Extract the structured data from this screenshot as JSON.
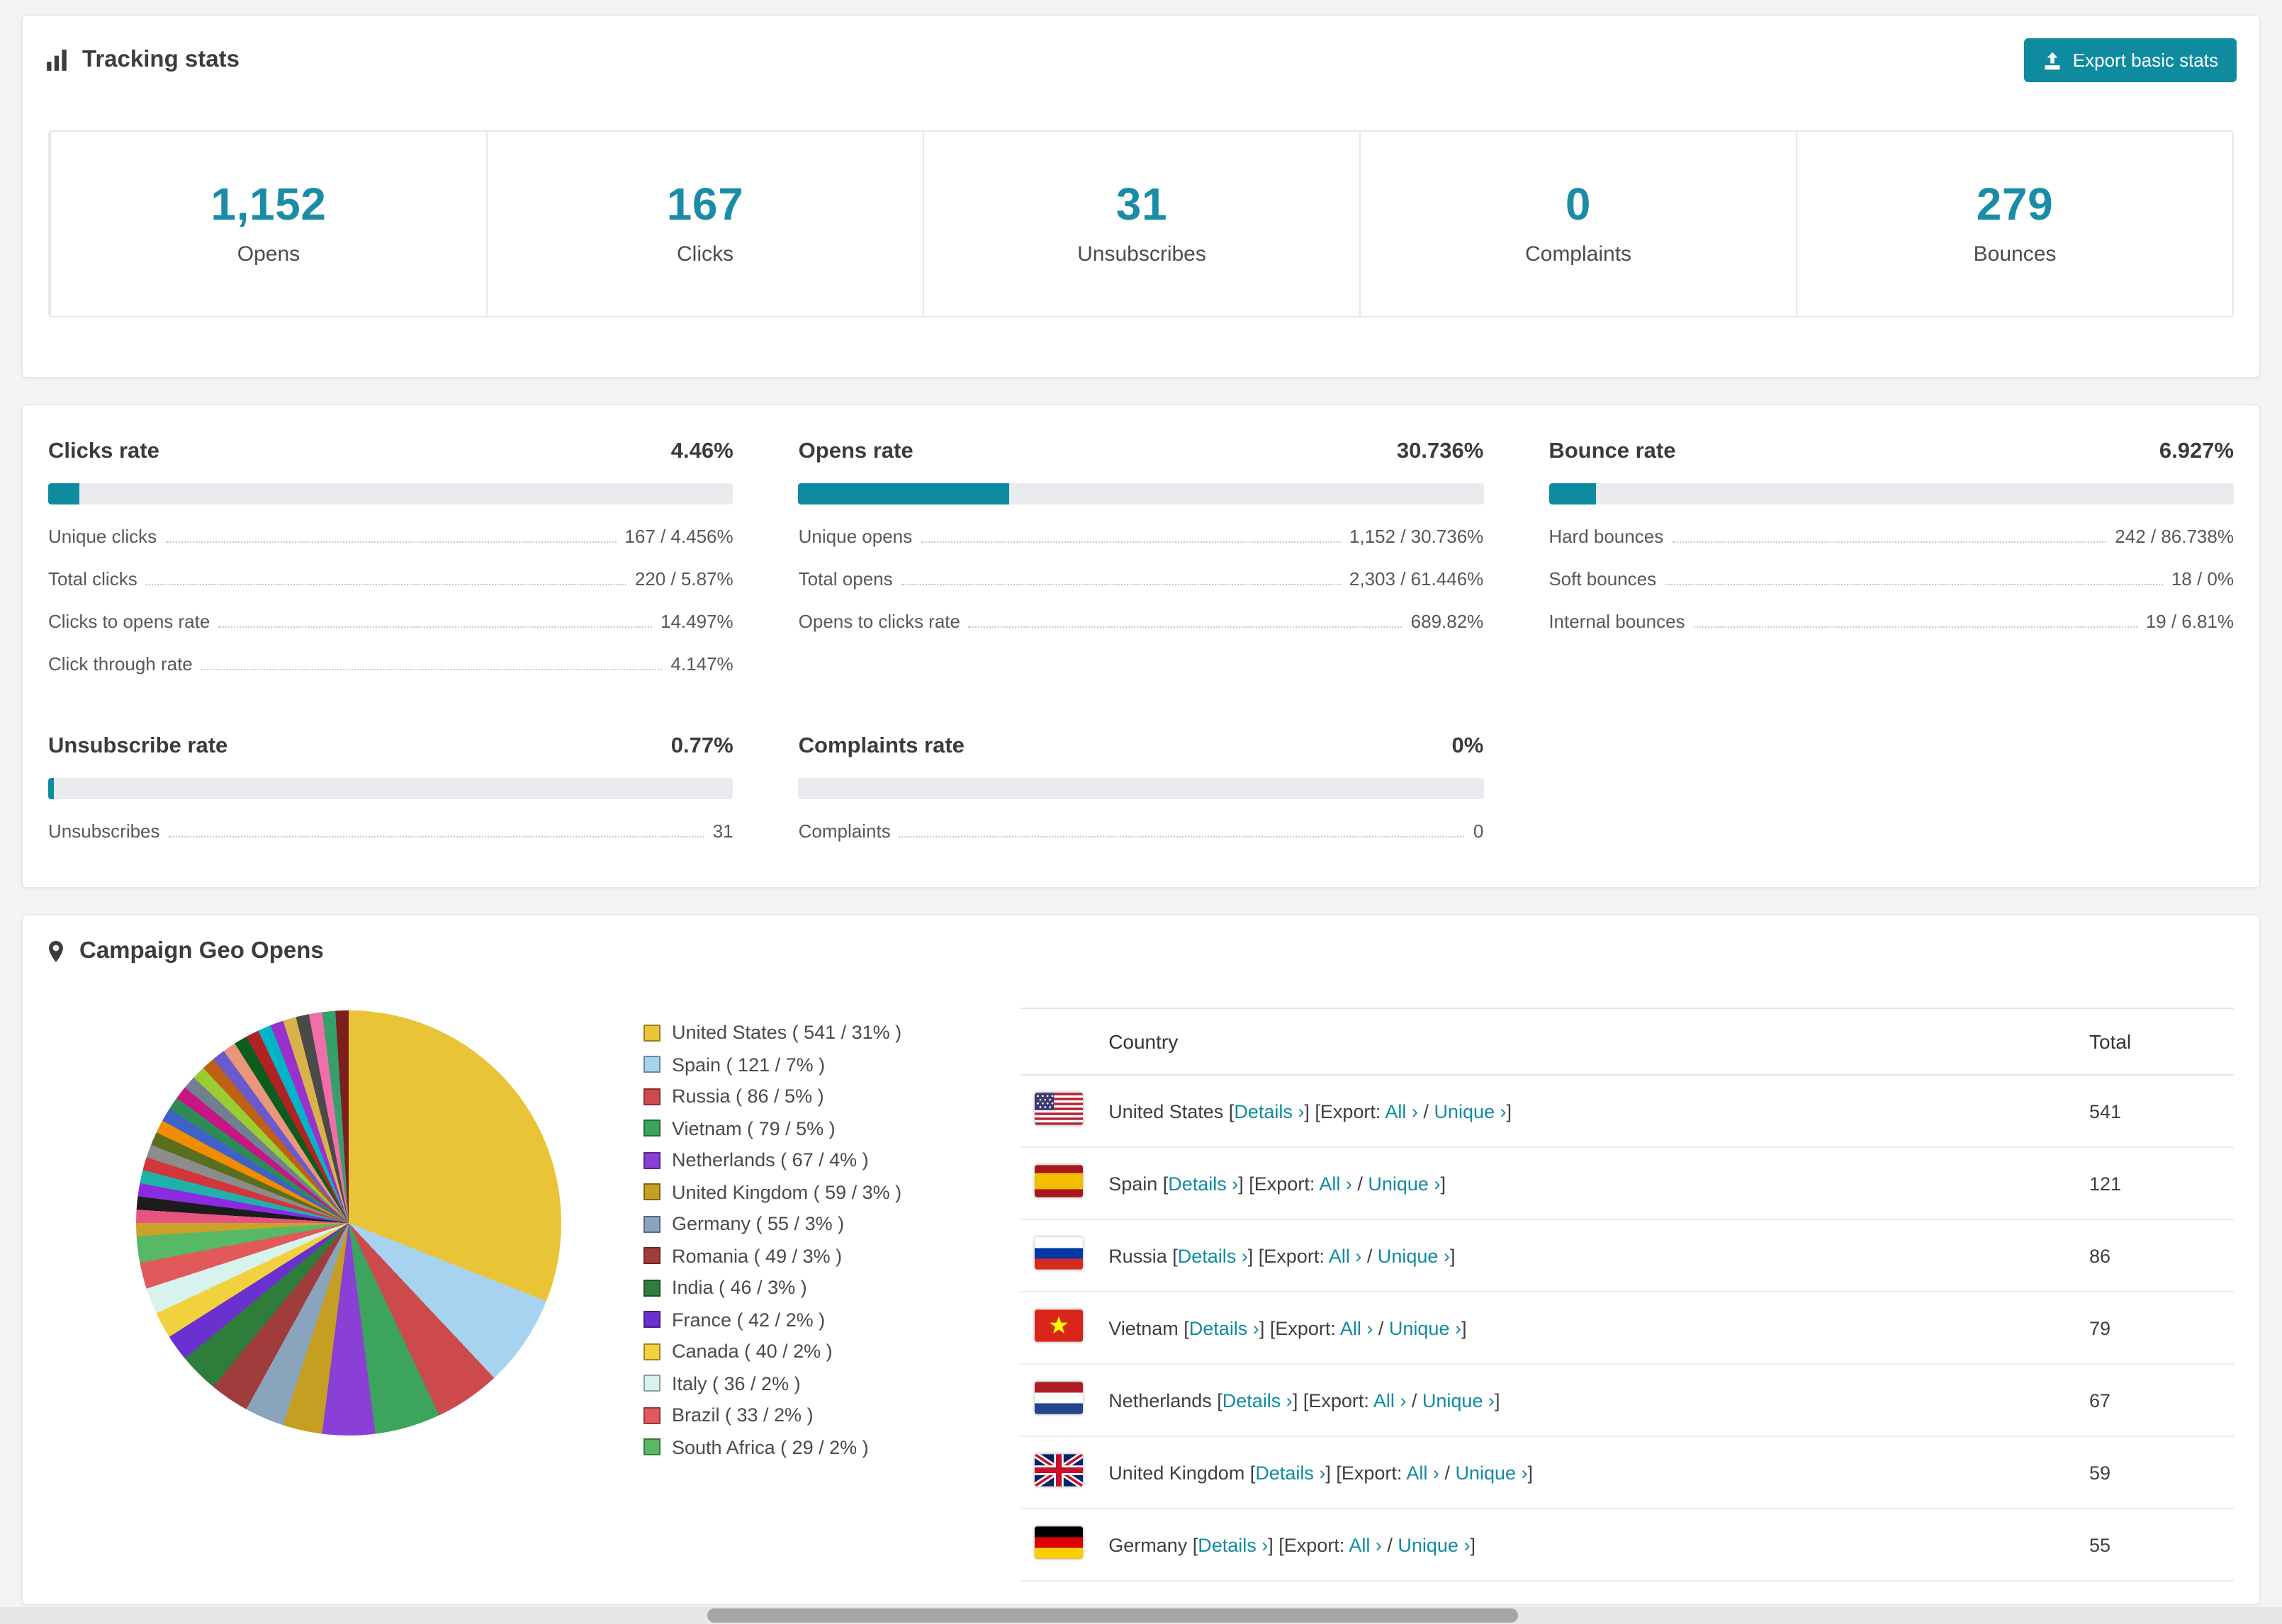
{
  "colors": {
    "accent": "#0f8ba0",
    "stat_number": "#1b8ca6",
    "bar_track": "#e9ebee",
    "page_bg": "#f4f4f4"
  },
  "tracking": {
    "title": "Tracking stats",
    "export_button": "Export basic stats",
    "stats": [
      {
        "value": "1,152",
        "label": "Opens"
      },
      {
        "value": "167",
        "label": "Clicks"
      },
      {
        "value": "31",
        "label": "Unsubscribes"
      },
      {
        "value": "0",
        "label": "Complaints"
      },
      {
        "value": "279",
        "label": "Bounces"
      }
    ]
  },
  "rates": [
    {
      "title": "Clicks rate",
      "value": "4.46%",
      "percent": 4.46,
      "rows": [
        {
          "label": "Unique clicks",
          "value": "167 / 4.456%"
        },
        {
          "label": "Total clicks",
          "value": "220 / 5.87%"
        },
        {
          "label": "Clicks to opens rate",
          "value": "14.497%"
        },
        {
          "label": "Click through rate",
          "value": "4.147%"
        }
      ]
    },
    {
      "title": "Opens rate",
      "value": "30.736%",
      "percent": 30.736,
      "rows": [
        {
          "label": "Unique opens",
          "value": "1,152 / 30.736%"
        },
        {
          "label": "Total opens",
          "value": "2,303 / 61.446%"
        },
        {
          "label": "Opens to clicks rate",
          "value": "689.82%"
        }
      ]
    },
    {
      "title": "Bounce rate",
      "value": "6.927%",
      "percent": 6.927,
      "rows": [
        {
          "label": "Hard bounces",
          "value": "242 / 86.738%"
        },
        {
          "label": "Soft bounces",
          "value": "18 / 0%"
        },
        {
          "label": "Internal bounces",
          "value": "19 / 6.81%"
        }
      ]
    },
    {
      "title": "Unsubscribe rate",
      "value": "0.77%",
      "percent": 0.77,
      "rows": [
        {
          "label": "Unsubscribes",
          "value": "31"
        }
      ]
    },
    {
      "title": "Complaints rate",
      "value": "0%",
      "percent": 0,
      "rows": [
        {
          "label": "Complaints",
          "value": "0"
        }
      ]
    }
  ],
  "geo": {
    "title": "Campaign Geo Opens",
    "table": {
      "headers": [
        "Country",
        "Total"
      ],
      "syntax": {
        "lb": "[",
        "rb": "]",
        "export": "Export:",
        "slash": "/",
        "details": "Details ›",
        "all": "All ›",
        "unique": "Unique ›"
      },
      "rows": [
        {
          "country": "United States",
          "flag": "us",
          "total": "541"
        },
        {
          "country": "Spain",
          "flag": "es",
          "total": "121"
        },
        {
          "country": "Russia",
          "flag": "ru",
          "total": "86"
        },
        {
          "country": "Vietnam",
          "flag": "vn",
          "total": "79"
        },
        {
          "country": "Netherlands",
          "flag": "nl",
          "total": "67"
        },
        {
          "country": "United Kingdom",
          "flag": "gb",
          "total": "59"
        },
        {
          "country": "Germany",
          "flag": "de",
          "total": "55"
        }
      ]
    }
  },
  "chart_data": {
    "type": "pie",
    "title": "Campaign Geo Opens",
    "legend_position": "right",
    "series": [
      {
        "label": "United States",
        "value": 541,
        "pct": 31,
        "color": "#e9c436"
      },
      {
        "label": "Spain",
        "value": 121,
        "pct": 7,
        "color": "#a8d3f0"
      },
      {
        "label": "Russia",
        "value": 86,
        "pct": 5,
        "color": "#cd4a4c"
      },
      {
        "label": "Vietnam",
        "value": 79,
        "pct": 5,
        "color": "#3da45e"
      },
      {
        "label": "Netherlands",
        "value": 67,
        "pct": 4,
        "color": "#8a3fd6"
      },
      {
        "label": "United Kingdom",
        "value": 59,
        "pct": 3,
        "color": "#c49f22"
      },
      {
        "label": "Germany",
        "value": 55,
        "pct": 3,
        "color": "#8aa4bd"
      },
      {
        "label": "Romania",
        "value": 49,
        "pct": 3,
        "color": "#a03c3c"
      },
      {
        "label": "India",
        "value": 46,
        "pct": 3,
        "color": "#2f7d3b"
      },
      {
        "label": "France",
        "value": 42,
        "pct": 2,
        "color": "#6a30d0"
      },
      {
        "label": "Canada",
        "value": 40,
        "pct": 2,
        "color": "#f2d13f"
      },
      {
        "label": "Italy",
        "value": 36,
        "pct": 2,
        "color": "#d8f2ee"
      },
      {
        "label": "Brazil",
        "value": 33,
        "pct": 2,
        "color": "#e2595b"
      },
      {
        "label": "South Africa",
        "value": 29,
        "pct": 2,
        "color": "#57b865"
      }
    ],
    "others": {
      "per_slice_pct": 1,
      "colors": [
        "#c9a227",
        "#e75480",
        "#1c1c1c",
        "#8a2be2",
        "#20b2aa",
        "#d2353a",
        "#8c8c8c",
        "#5a6e1e",
        "#f08c00",
        "#3f62c8",
        "#2e8b57",
        "#c71585",
        "#708090",
        "#9acd32",
        "#c06014",
        "#6a5acd",
        "#e9967a",
        "#0b5d1e",
        "#b22222",
        "#00b5c8",
        "#9932cc",
        "#d8b24a",
        "#4a4a4a",
        "#f06eaa",
        "#35a06a",
        "#7d1f1f"
      ]
    }
  }
}
